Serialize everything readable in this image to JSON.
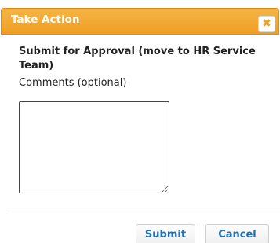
{
  "dialog": {
    "title": "Take Action",
    "close_glyph": "✖",
    "close_icon": "close-icon",
    "heading": "Submit for Approval (move to HR Service Team)",
    "comments_label": "Comments (optional)",
    "comments_value": ""
  },
  "buttons": {
    "submit_label": "Submit",
    "cancel_label": "Cancel"
  },
  "colors": {
    "titlebar": "#ef9f22",
    "button_text": "#1f6fb5"
  }
}
